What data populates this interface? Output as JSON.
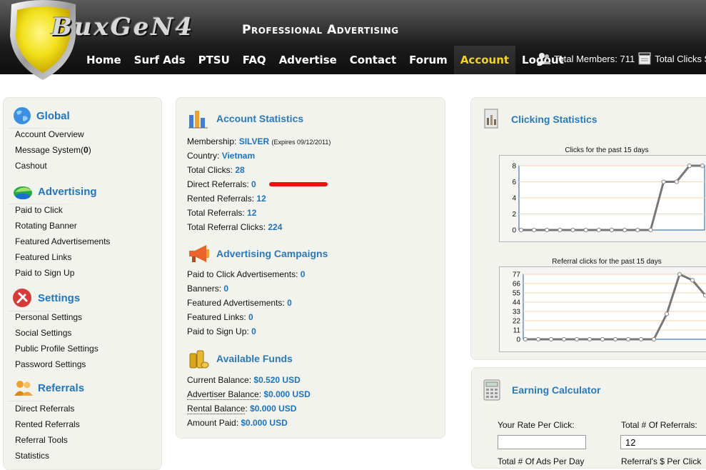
{
  "header": {
    "logo_text": "BuxGeN4",
    "tagline": "Professional Advertising",
    "nav": [
      "Home",
      "Surf Ads",
      "PTSU",
      "FAQ",
      "Advertise",
      "Contact",
      "Forum",
      "Account",
      "Logout"
    ],
    "active_nav": "Account",
    "total_members": "Total Members: 711",
    "total_clicks": "Total Clicks Se"
  },
  "sidebar": {
    "global": {
      "title": "Global",
      "icon": "globe-icon",
      "items": [
        "Account Overview",
        "Message System(",
        "Cashout"
      ],
      "message_count": "0",
      "message_close": ")"
    },
    "advertising": {
      "title": "Advertising",
      "icon": "advertising-icon",
      "items": [
        "Paid to Click",
        "Rotating Banner",
        "Featured Advertisements",
        "Featured Links",
        "Paid to Sign Up"
      ]
    },
    "settings": {
      "title": "Settings",
      "icon": "tools-icon",
      "items": [
        "Personal Settings",
        "Social Settings",
        "Public Profile Settings",
        "Password Settings"
      ]
    },
    "referrals": {
      "title": "Referrals",
      "icon": "people-icon",
      "items": [
        "Direct Referrals",
        "Rented Referrals",
        "Referral Tools",
        "Statistics"
      ]
    }
  },
  "account_statistics": {
    "title": "Account Statistics",
    "membership_label": "Membership: ",
    "membership_value": "SILVER",
    "membership_expires": "(Expires 09/12/2011)",
    "country_label": "Country: ",
    "country_value": "Vietnam",
    "total_clicks_label": "Total Clicks: ",
    "total_clicks_value": "28",
    "direct_referrals_label": "Direct Referrals: ",
    "direct_referrals_value": "0",
    "rented_referrals_label": "Rented Referrals: ",
    "rented_referrals_value": "12",
    "total_referrals_label": "Total Referrals: ",
    "total_referrals_value": "12",
    "total_referral_clicks_label": "Total Referral Clicks: ",
    "total_referral_clicks_value": "224"
  },
  "advertising_campaigns": {
    "title": "Advertising Campaigns",
    "ptc_label": "Paid to Click Advertisements: ",
    "ptc_value": "0",
    "banners_label": "Banners: ",
    "banners_value": "0",
    "featured_ads_label": "Featured Advertisements: ",
    "featured_ads_value": "0",
    "featured_links_label": "Featured Links: ",
    "featured_links_value": "0",
    "ptsu_label": "Paid to Sign Up: ",
    "ptsu_value": "0"
  },
  "available_funds": {
    "title": "Available Funds",
    "current_label": "Current Balance: ",
    "current_value": "$0.520 USD",
    "advertiser_label": "Advertiser Balance",
    "advertiser_colon": ":",
    "advertiser_value": "$0.000 USD",
    "rental_label": "Rental Balance",
    "rental_colon": ":",
    "rental_value": "$0.000 USD",
    "paid_label": "Amount Paid: ",
    "paid_value": "$0.000 USD"
  },
  "clicking_statistics": {
    "title": "Clicking Statistics"
  },
  "earning_calculator": {
    "title": "Earning Calculator",
    "rate_label": "Your Rate Per Click:",
    "rate_value": "",
    "referrals_label": "Total # Of Referrals:",
    "referrals_value": "12",
    "ads_label": "Total # Of Ads Per Day",
    "ref_clicks_label": "Referral's $ Per Click"
  },
  "annotation_color": "#ee1111",
  "chart_data": [
    {
      "type": "line",
      "title": "Clicks for the past 15 days",
      "xlabel": "",
      "ylabel": "",
      "yticks": [
        0,
        2,
        4,
        6,
        8
      ],
      "ylim": [
        0,
        8
      ],
      "series": [
        {
          "values": [
            0,
            0,
            0,
            0,
            0,
            0,
            0,
            0,
            0,
            0,
            0,
            6,
            6,
            8,
            8
          ]
        }
      ],
      "line_color": "#777777",
      "grid": true
    },
    {
      "type": "line",
      "title": "Referral clicks for the past 15 days",
      "xlabel": "",
      "ylabel": "",
      "yticks": [
        0,
        11,
        22,
        33,
        44,
        55,
        66,
        77
      ],
      "ylim": [
        0,
        77
      ],
      "series": [
        {
          "values": [
            0,
            0,
            0,
            0,
            0,
            0,
            0,
            0,
            0,
            0,
            0,
            30,
            77,
            70,
            52
          ]
        }
      ],
      "line_color": "#777777",
      "grid": true
    }
  ]
}
